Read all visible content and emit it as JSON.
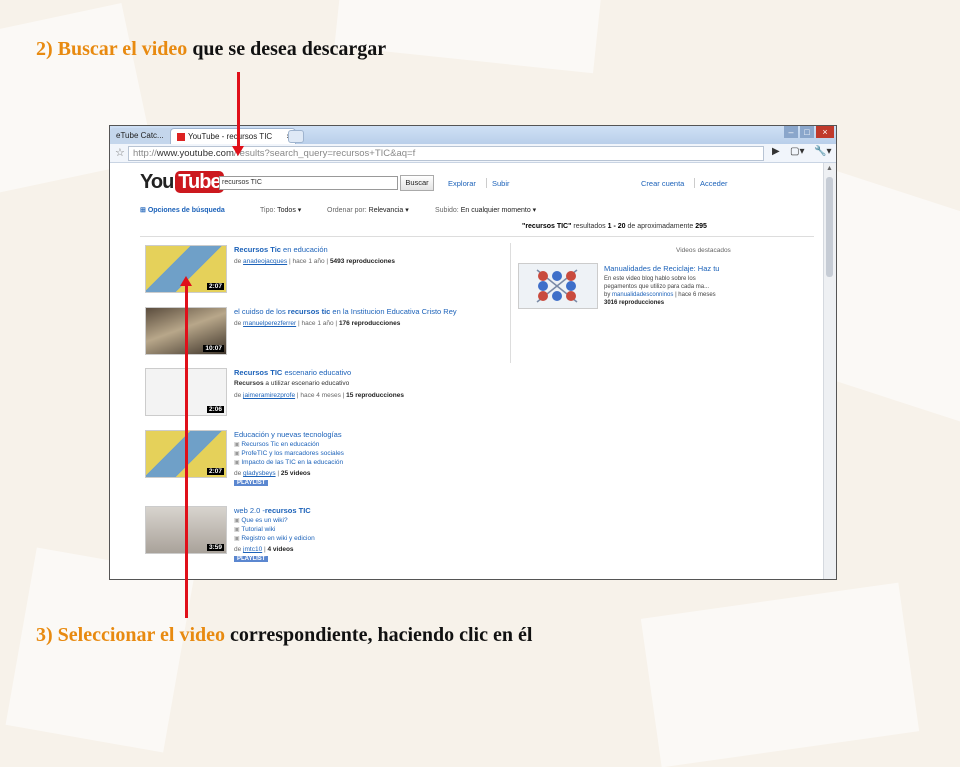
{
  "slide": {
    "step2": {
      "num": "2)",
      "highlight": "Buscar el video",
      "rest": " que se desea descargar"
    },
    "step3": {
      "num": "3)",
      "highlight": "Seleccionar el video",
      "rest": " correspondiente, haciendo clic en él"
    },
    "colors": {
      "highlight": "#e88a10",
      "arrow": "#e0101a"
    }
  },
  "browser": {
    "tabs": [
      {
        "label": "eTube Catc..."
      },
      {
        "label": "YouTube - recursos TIC",
        "close": "×"
      }
    ],
    "window_buttons": {
      "minimize": "–",
      "maximize": "□",
      "close": "×"
    },
    "url": {
      "prefix": "http://",
      "host": "www.youtube.com",
      "path": "/results?search_query=recursos+TIC&aq=f"
    }
  },
  "youtube": {
    "logo_you": "You",
    "logo_tube": "Tube",
    "search_value": "recursos TIC",
    "search_button": "Buscar",
    "nav": {
      "explorar": "Explorar",
      "subir": "Subir",
      "crear": "Crear cuenta",
      "acceder": "Acceder"
    },
    "filters": {
      "opciones": "Opciones de búsqueda",
      "tipo_label": "Tipo:",
      "tipo_val": "Todos ▾",
      "ordenar_label": "Ordenar por:",
      "ordenar_val": "Relevancia ▾",
      "subido_label": "Subido:",
      "subido_val": "En cualquier momento ▾"
    },
    "results_count": {
      "query": "\"recursos TIC\"",
      "text": " resultados ",
      "range": "1 - 20",
      "tail": " de aproximadamente ",
      "total": "295"
    },
    "results": [
      {
        "title_b": "Recursos Tic",
        "title_rest": " en educación",
        "meta_pre": "de ",
        "user": "anadeojacques",
        "age": " | hace 1 año | ",
        "views": "5493 reproducciones",
        "duration": "2:07"
      },
      {
        "title_pre": "el cuidso de los ",
        "title_b": "recursos tic",
        "title_rest": " en la Institucion Educativa Cristo Rey",
        "meta_pre": "de ",
        "user": "manuelperezferrer",
        "age": " | hace 1 año | ",
        "views": "176 reproducciones",
        "duration": "10:07"
      },
      {
        "title_b": "Recursos TIC",
        "title_rest": " escenario educativo",
        "desc_b": "Recursos",
        "desc_rest": " a utilizar escenario educativo",
        "meta_pre": "de ",
        "user": "jaimeramirezprofe",
        "age": " | hace 4 meses | ",
        "views": "15 reproducciones",
        "duration": "2:06"
      },
      {
        "title": "Educación y nuevas tecnologías",
        "items": [
          "Recursos Tic en educación",
          "ProfeTIC y los marcadores sociales",
          "Impacto de las TIC en la educación"
        ],
        "meta_pre": "de ",
        "user": "gladysbeys",
        "age": " | ",
        "views": "25 videos",
        "badge": "PLAYLIST",
        "duration": "2:07"
      },
      {
        "title_pre": "web 2.0 -",
        "title_b": "recursos TIC",
        "items": [
          "Que es un wiki?",
          "Tutorial wiki",
          "Registro en wiki y edicion"
        ],
        "meta_pre": "de ",
        "user": "jmtc10",
        "age": " | ",
        "views": "4 videos",
        "badge": "PLAYLIST",
        "duration": "3:59"
      }
    ],
    "featured": {
      "label": "Videos destacados",
      "title": "Manualidades de Reciclaje: Haz tu",
      "desc1": "En este video blog hablo sobre los",
      "desc2": "pegamentos que utilizo para cada ma...",
      "by_pre": "by ",
      "by_user": "manualidadesconninos",
      "by_age": " | hace 6 meses",
      "views": "3016 reproducciones"
    }
  }
}
